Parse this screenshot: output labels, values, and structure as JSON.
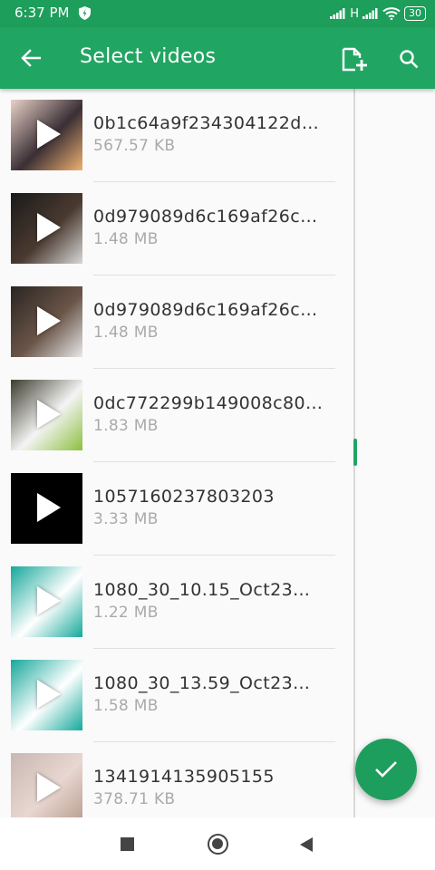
{
  "status_bar": {
    "time": "6:37 PM",
    "network_label": "H",
    "battery": "30"
  },
  "app_bar": {
    "title": "Select videos",
    "back_icon": "arrow-back-icon",
    "add_file_icon": "add-file-icon",
    "search_icon": "search-icon"
  },
  "videos": [
    {
      "name": "0b1c64a9f234304122d…",
      "size": "567.57 KB",
      "thumb": [
        "#e9d2c8",
        "#3a2f35",
        "#f0b070"
      ]
    },
    {
      "name": "0d979089d6c169af26c…",
      "size": "1.48 MB",
      "thumb": [
        "#1a1a1a",
        "#4a3a30",
        "#d8d8d8"
      ]
    },
    {
      "name": "0d979089d6c169af26c…",
      "size": "1.48 MB",
      "thumb": [
        "#2a2522",
        "#6a5548",
        "#e8e8e8"
      ]
    },
    {
      "name": "0dc772299b149008c80…",
      "size": "1.83 MB",
      "thumb": [
        "#3c3c2e",
        "#f4f4f4",
        "#8cbf3f"
      ]
    },
    {
      "name": "1057160237803203",
      "size": "3.33 MB",
      "thumb": [
        "#000000",
        "#000000",
        "#000000"
      ]
    },
    {
      "name": "1080_30_10.15_Oct23…",
      "size": "1.22 MB",
      "thumb": [
        "#15a89b",
        "#ffffff",
        "#15a89b"
      ]
    },
    {
      "name": "1080_30_13.59_Oct23…",
      "size": "1.58 MB",
      "thumb": [
        "#15a89b",
        "#ffffff",
        "#15a89b"
      ]
    },
    {
      "name": "1341914135905155",
      "size": "378.71 KB",
      "thumb": [
        "#c9b7b3",
        "#e8d6d0",
        "#b89c8e"
      ]
    }
  ],
  "fab_icon": "check-icon",
  "nav_bar": {
    "recent_icon": "recent-apps-icon",
    "home_icon": "home-icon",
    "back_icon": "nav-back-icon"
  },
  "colors": {
    "status_bar": "#1d9e5a",
    "app_bar": "#21a563",
    "fab": "#1e9e5c"
  }
}
